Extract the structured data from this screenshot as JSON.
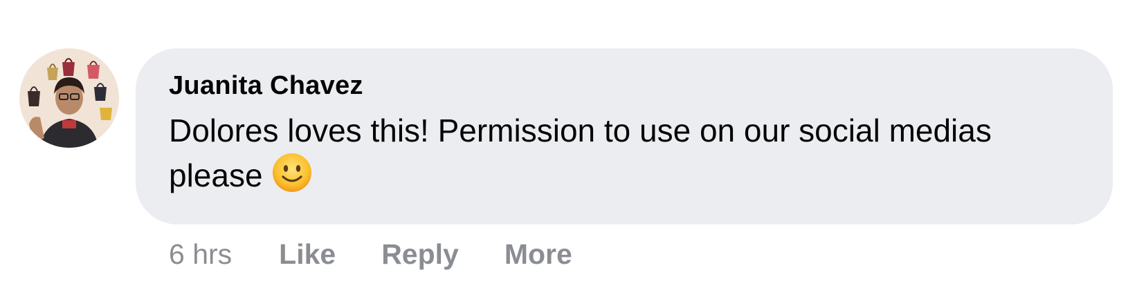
{
  "comment": {
    "author": "Juanita Chavez",
    "text": "Dolores loves this! Permission to use on our social medias please",
    "emoji": "slightly-smiling-face-icon",
    "timestamp": "6 hrs",
    "actions": {
      "like": "Like",
      "reply": "Reply",
      "more": "More"
    }
  },
  "colors": {
    "bubble_background": "#ebedf0",
    "text": "#050505",
    "secondary_text": "#8a8d91",
    "emoji_fill": "#fbc02d"
  }
}
